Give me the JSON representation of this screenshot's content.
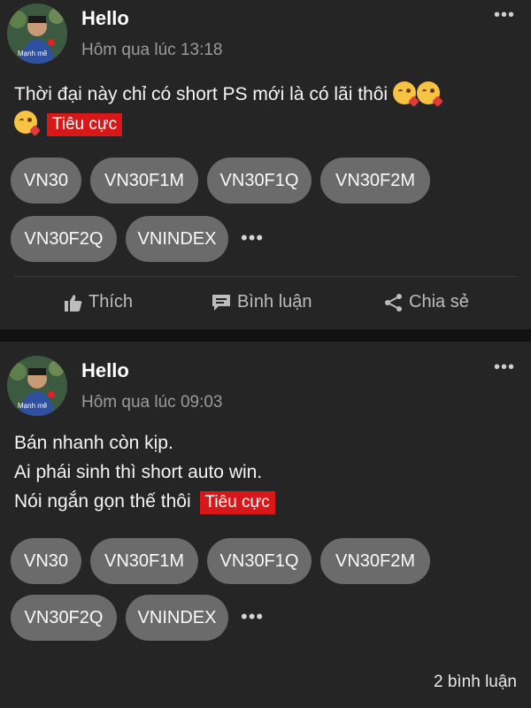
{
  "posts": [
    {
      "author": "Hello",
      "avatar_caption": "Mạnh mẽ",
      "time": "Hôm qua lúc 13:18",
      "text_lines": [
        "Thời đại này chỉ có short PS mới là có lãi thôi"
      ],
      "sentiment": "Tiêu cực",
      "tags": [
        "VN30",
        "VN30F1M",
        "VN30F1Q",
        "VN30F2M",
        "VN30F2Q",
        "VNINDEX"
      ],
      "more_tags": "•••",
      "menu": "•••",
      "actions": {
        "like": "Thích",
        "comment": "Bình luận",
        "share": "Chia sẻ"
      }
    },
    {
      "author": "Hello",
      "avatar_caption": "Mạnh mẽ",
      "time": "Hôm qua lúc 09:03",
      "text_lines": [
        "Bán nhanh còn kịp.",
        "Ai phái sinh thì short auto win.",
        "Nói ngắn gọn thế thôi"
      ],
      "sentiment": "Tiêu cực",
      "tags": [
        "VN30",
        "VN30F1M",
        "VN30F1Q",
        "VN30F2M",
        "VN30F2Q",
        "VNINDEX"
      ],
      "more_tags": "•••",
      "menu": "•••",
      "comment_count": "2 bình luận"
    }
  ],
  "colors": {
    "background": "#121212",
    "card": "#252525",
    "chip": "#6b6b6b",
    "sentiment_tag": "#d81818",
    "muted_text": "#9a9a9a"
  }
}
